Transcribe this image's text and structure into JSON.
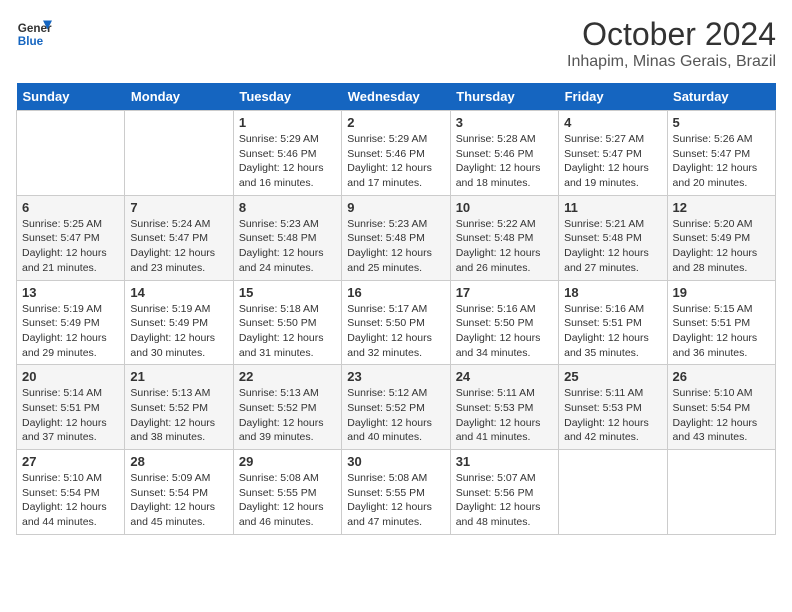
{
  "header": {
    "logo_general": "General",
    "logo_blue": "Blue",
    "month": "October 2024",
    "location": "Inhapim, Minas Gerais, Brazil"
  },
  "days_of_week": [
    "Sunday",
    "Monday",
    "Tuesday",
    "Wednesday",
    "Thursday",
    "Friday",
    "Saturday"
  ],
  "weeks": [
    [
      {
        "day": "",
        "sunrise": "",
        "sunset": "",
        "daylight": ""
      },
      {
        "day": "",
        "sunrise": "",
        "sunset": "",
        "daylight": ""
      },
      {
        "day": "1",
        "sunrise": "Sunrise: 5:29 AM",
        "sunset": "Sunset: 5:46 PM",
        "daylight": "Daylight: 12 hours and 16 minutes."
      },
      {
        "day": "2",
        "sunrise": "Sunrise: 5:29 AM",
        "sunset": "Sunset: 5:46 PM",
        "daylight": "Daylight: 12 hours and 17 minutes."
      },
      {
        "day": "3",
        "sunrise": "Sunrise: 5:28 AM",
        "sunset": "Sunset: 5:46 PM",
        "daylight": "Daylight: 12 hours and 18 minutes."
      },
      {
        "day": "4",
        "sunrise": "Sunrise: 5:27 AM",
        "sunset": "Sunset: 5:47 PM",
        "daylight": "Daylight: 12 hours and 19 minutes."
      },
      {
        "day": "5",
        "sunrise": "Sunrise: 5:26 AM",
        "sunset": "Sunset: 5:47 PM",
        "daylight": "Daylight: 12 hours and 20 minutes."
      }
    ],
    [
      {
        "day": "6",
        "sunrise": "Sunrise: 5:25 AM",
        "sunset": "Sunset: 5:47 PM",
        "daylight": "Daylight: 12 hours and 21 minutes."
      },
      {
        "day": "7",
        "sunrise": "Sunrise: 5:24 AM",
        "sunset": "Sunset: 5:47 PM",
        "daylight": "Daylight: 12 hours and 23 minutes."
      },
      {
        "day": "8",
        "sunrise": "Sunrise: 5:23 AM",
        "sunset": "Sunset: 5:48 PM",
        "daylight": "Daylight: 12 hours and 24 minutes."
      },
      {
        "day": "9",
        "sunrise": "Sunrise: 5:23 AM",
        "sunset": "Sunset: 5:48 PM",
        "daylight": "Daylight: 12 hours and 25 minutes."
      },
      {
        "day": "10",
        "sunrise": "Sunrise: 5:22 AM",
        "sunset": "Sunset: 5:48 PM",
        "daylight": "Daylight: 12 hours and 26 minutes."
      },
      {
        "day": "11",
        "sunrise": "Sunrise: 5:21 AM",
        "sunset": "Sunset: 5:48 PM",
        "daylight": "Daylight: 12 hours and 27 minutes."
      },
      {
        "day": "12",
        "sunrise": "Sunrise: 5:20 AM",
        "sunset": "Sunset: 5:49 PM",
        "daylight": "Daylight: 12 hours and 28 minutes."
      }
    ],
    [
      {
        "day": "13",
        "sunrise": "Sunrise: 5:19 AM",
        "sunset": "Sunset: 5:49 PM",
        "daylight": "Daylight: 12 hours and 29 minutes."
      },
      {
        "day": "14",
        "sunrise": "Sunrise: 5:19 AM",
        "sunset": "Sunset: 5:49 PM",
        "daylight": "Daylight: 12 hours and 30 minutes."
      },
      {
        "day": "15",
        "sunrise": "Sunrise: 5:18 AM",
        "sunset": "Sunset: 5:50 PM",
        "daylight": "Daylight: 12 hours and 31 minutes."
      },
      {
        "day": "16",
        "sunrise": "Sunrise: 5:17 AM",
        "sunset": "Sunset: 5:50 PM",
        "daylight": "Daylight: 12 hours and 32 minutes."
      },
      {
        "day": "17",
        "sunrise": "Sunrise: 5:16 AM",
        "sunset": "Sunset: 5:50 PM",
        "daylight": "Daylight: 12 hours and 34 minutes."
      },
      {
        "day": "18",
        "sunrise": "Sunrise: 5:16 AM",
        "sunset": "Sunset: 5:51 PM",
        "daylight": "Daylight: 12 hours and 35 minutes."
      },
      {
        "day": "19",
        "sunrise": "Sunrise: 5:15 AM",
        "sunset": "Sunset: 5:51 PM",
        "daylight": "Daylight: 12 hours and 36 minutes."
      }
    ],
    [
      {
        "day": "20",
        "sunrise": "Sunrise: 5:14 AM",
        "sunset": "Sunset: 5:51 PM",
        "daylight": "Daylight: 12 hours and 37 minutes."
      },
      {
        "day": "21",
        "sunrise": "Sunrise: 5:13 AM",
        "sunset": "Sunset: 5:52 PM",
        "daylight": "Daylight: 12 hours and 38 minutes."
      },
      {
        "day": "22",
        "sunrise": "Sunrise: 5:13 AM",
        "sunset": "Sunset: 5:52 PM",
        "daylight": "Daylight: 12 hours and 39 minutes."
      },
      {
        "day": "23",
        "sunrise": "Sunrise: 5:12 AM",
        "sunset": "Sunset: 5:52 PM",
        "daylight": "Daylight: 12 hours and 40 minutes."
      },
      {
        "day": "24",
        "sunrise": "Sunrise: 5:11 AM",
        "sunset": "Sunset: 5:53 PM",
        "daylight": "Daylight: 12 hours and 41 minutes."
      },
      {
        "day": "25",
        "sunrise": "Sunrise: 5:11 AM",
        "sunset": "Sunset: 5:53 PM",
        "daylight": "Daylight: 12 hours and 42 minutes."
      },
      {
        "day": "26",
        "sunrise": "Sunrise: 5:10 AM",
        "sunset": "Sunset: 5:54 PM",
        "daylight": "Daylight: 12 hours and 43 minutes."
      }
    ],
    [
      {
        "day": "27",
        "sunrise": "Sunrise: 5:10 AM",
        "sunset": "Sunset: 5:54 PM",
        "daylight": "Daylight: 12 hours and 44 minutes."
      },
      {
        "day": "28",
        "sunrise": "Sunrise: 5:09 AM",
        "sunset": "Sunset: 5:54 PM",
        "daylight": "Daylight: 12 hours and 45 minutes."
      },
      {
        "day": "29",
        "sunrise": "Sunrise: 5:08 AM",
        "sunset": "Sunset: 5:55 PM",
        "daylight": "Daylight: 12 hours and 46 minutes."
      },
      {
        "day": "30",
        "sunrise": "Sunrise: 5:08 AM",
        "sunset": "Sunset: 5:55 PM",
        "daylight": "Daylight: 12 hours and 47 minutes."
      },
      {
        "day": "31",
        "sunrise": "Sunrise: 5:07 AM",
        "sunset": "Sunset: 5:56 PM",
        "daylight": "Daylight: 12 hours and 48 minutes."
      },
      {
        "day": "",
        "sunrise": "",
        "sunset": "",
        "daylight": ""
      },
      {
        "day": "",
        "sunrise": "",
        "sunset": "",
        "daylight": ""
      }
    ]
  ]
}
